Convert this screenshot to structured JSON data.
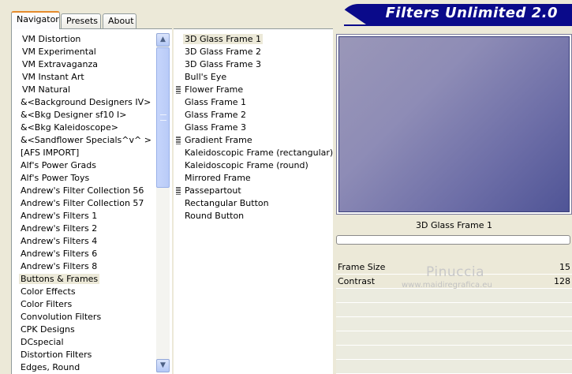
{
  "app": {
    "title": "Filters Unlimited 2.0"
  },
  "tabs": [
    {
      "label": "Navigator",
      "active": true
    },
    {
      "label": "Presets",
      "active": false
    },
    {
      "label": "About",
      "active": false
    }
  ],
  "categories": [
    {
      "label": "VM Distortion"
    },
    {
      "label": "VM Experimental"
    },
    {
      "label": "VM Extravaganza"
    },
    {
      "label": "VM Instant Art"
    },
    {
      "label": "VM Natural"
    },
    {
      "label": "&<Background Designers IV>"
    },
    {
      "label": "&<Bkg Designer sf10 I>"
    },
    {
      "label": "&<Bkg Kaleidoscope>"
    },
    {
      "label": "&<Sandflower Specials^v^ >"
    },
    {
      "label": "[AFS IMPORT]"
    },
    {
      "label": "Alf's Power Grads"
    },
    {
      "label": "Alf's Power Toys"
    },
    {
      "label": "Andrew's Filter Collection 56"
    },
    {
      "label": "Andrew's Filter Collection 57"
    },
    {
      "label": "Andrew's Filters 1"
    },
    {
      "label": "Andrew's Filters 2"
    },
    {
      "label": "Andrew's Filters 4"
    },
    {
      "label": "Andrew's Filters 6"
    },
    {
      "label": "Andrew's Filters 8"
    },
    {
      "label": "Buttons & Frames"
    },
    {
      "label": "Color Effects"
    },
    {
      "label": "Color Filters"
    },
    {
      "label": "Convolution Filters"
    },
    {
      "label": "CPK Designs"
    },
    {
      "label": "DCspecial"
    },
    {
      "label": "Distortion Filters"
    },
    {
      "label": "Edges, Round"
    }
  ],
  "selected_category": "Buttons & Frames",
  "filters": [
    {
      "label": "3D Glass Frame 1",
      "has_marker": false
    },
    {
      "label": "3D Glass Frame 2",
      "has_marker": false
    },
    {
      "label": "3D Glass Frame 3",
      "has_marker": false
    },
    {
      "label": "Bull's Eye",
      "has_marker": false
    },
    {
      "label": "Flower Frame",
      "has_marker": true
    },
    {
      "label": "Glass Frame 1",
      "has_marker": false
    },
    {
      "label": "Glass Frame 2",
      "has_marker": false
    },
    {
      "label": "Glass Frame 3",
      "has_marker": false
    },
    {
      "label": "Gradient Frame",
      "has_marker": true
    },
    {
      "label": "Kaleidoscopic Frame (rectangular)",
      "has_marker": false
    },
    {
      "label": "Kaleidoscopic Frame (round)",
      "has_marker": false
    },
    {
      "label": "Mirrored Frame",
      "has_marker": false
    },
    {
      "label": "Passepartout",
      "has_marker": true
    },
    {
      "label": "Rectangular Button",
      "has_marker": false
    },
    {
      "label": "Round Button",
      "has_marker": false
    }
  ],
  "selected_filter": "3D Glass Frame 1",
  "preview": {
    "filter_name": "3D Glass Frame 1"
  },
  "params": [
    {
      "name": "Frame Size",
      "value": "15"
    },
    {
      "name": "Contrast",
      "value": "128"
    }
  ],
  "watermark": {
    "name": "Pinuccia",
    "site": "www.maidiregrafica.eu"
  },
  "colors": {
    "title_banner": "#0a0a8a",
    "tab_active_accent": "#e68b2c",
    "window_bg": "#ece9d8"
  }
}
